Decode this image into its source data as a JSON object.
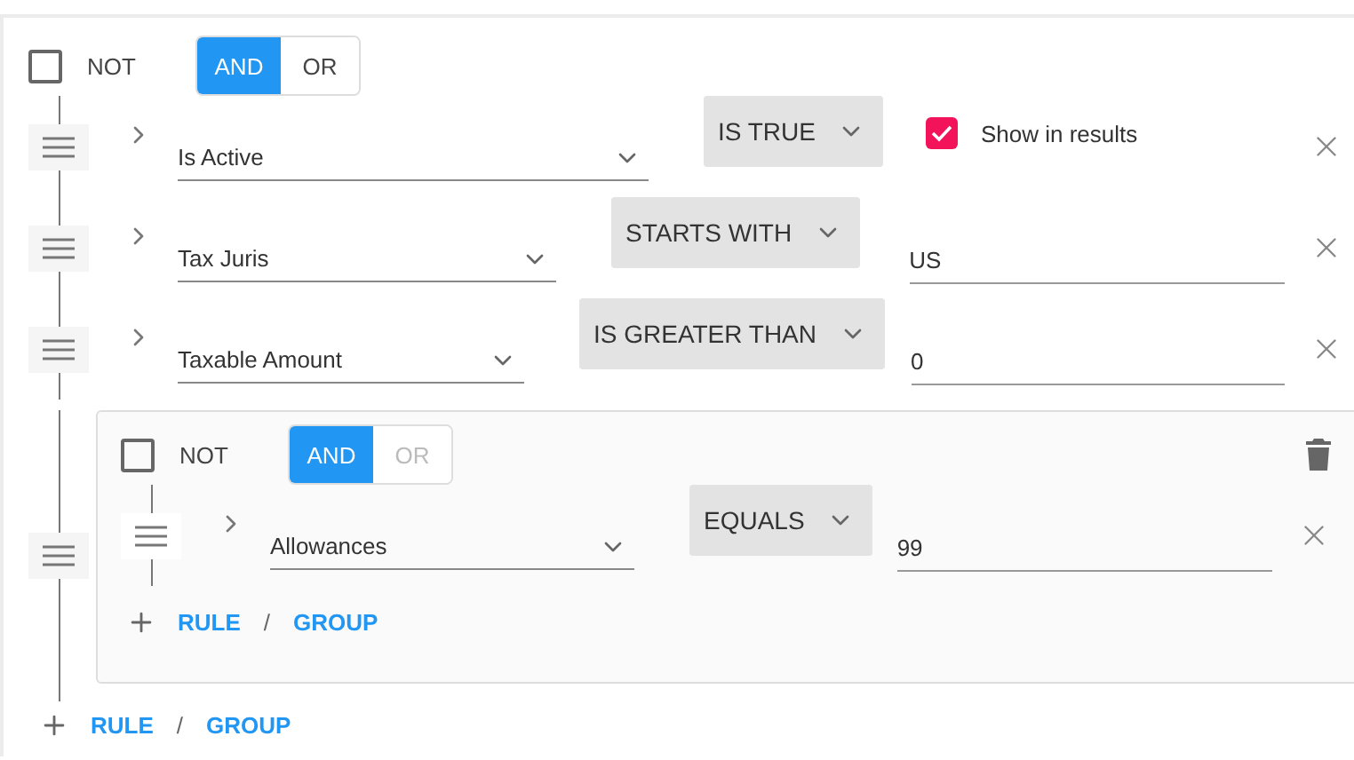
{
  "root": {
    "not": false,
    "not_label": "NOT",
    "combinator": [
      {
        "label": "AND",
        "selected": true,
        "disabled": false
      },
      {
        "label": "OR",
        "selected": false,
        "disabled": false
      }
    ],
    "rules": [
      {
        "kind": "rule",
        "field": "Is Active",
        "operator": "IS TRUE",
        "show_in_results": {
          "label": "Show in results",
          "checked": true
        }
      },
      {
        "kind": "rule",
        "field": "Tax Juris",
        "operator": "STARTS WITH",
        "value": "US"
      },
      {
        "kind": "rule",
        "field": "Taxable Amount",
        "operator": "IS GREATER THAN",
        "value": "0"
      },
      {
        "kind": "group",
        "not": false,
        "not_label": "NOT",
        "combinator": [
          {
            "label": "AND",
            "selected": true,
            "disabled": false
          },
          {
            "label": "OR",
            "selected": false,
            "disabled": true
          }
        ],
        "rules": [
          {
            "kind": "rule",
            "field": "Allowances",
            "operator": "EQUALS",
            "value": "99"
          }
        ],
        "add": {
          "rule": "RULE",
          "separator": "/",
          "group": "GROUP"
        }
      }
    ],
    "add": {
      "rule": "RULE",
      "separator": "/",
      "group": "GROUP"
    }
  }
}
